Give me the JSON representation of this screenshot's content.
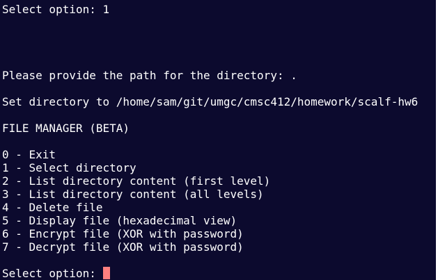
{
  "terminal": {
    "prev_prompt": "Select option: 1",
    "path_prompt": "Please provide the path for the directory: .",
    "set_directory": "Set directory to /home/sam/git/umgc/cmsc412/homework/scalf-hw6",
    "menu_title": "FILE MANAGER (BETA)",
    "menu": [
      "0 - Exit",
      "1 - Select directory",
      "2 - List directory content (first level)",
      "3 - List directory content (all levels)",
      "4 - Delete file",
      "5 - Display file (hexadecimal view)",
      "6 - Encrypt file (XOR with password)",
      "7 - Decrypt file (XOR with password)"
    ],
    "current_prompt": "Select option: "
  },
  "colors": {
    "background": "#0c0a2e",
    "text": "#ffffff",
    "cursor": "#ff7f7f"
  }
}
